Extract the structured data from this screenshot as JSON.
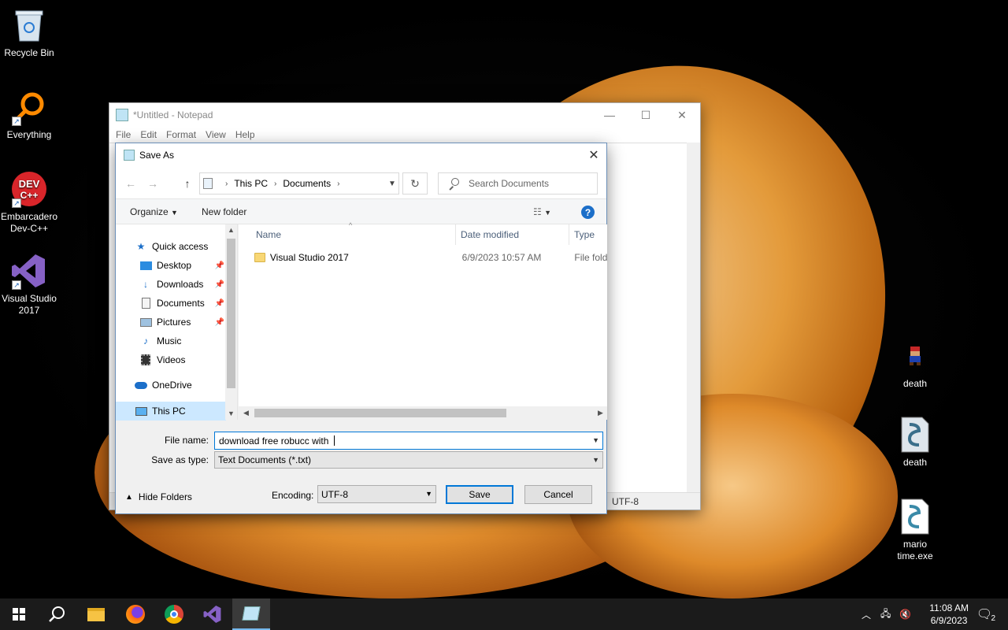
{
  "desktop": {
    "icons_left": [
      {
        "label": "Recycle Bin",
        "icon": "recycle-bin-icon"
      },
      {
        "label": "Everything",
        "icon": "everything-icon"
      },
      {
        "label": "Embarcadero Dev-C++",
        "icon": "dev-cpp-icon"
      },
      {
        "label": "Visual Studio 2017",
        "icon": "visual-studio-icon"
      }
    ],
    "icons_right": [
      {
        "label": "death",
        "icon": "mario-sprite-icon"
      },
      {
        "label": "death",
        "icon": "python-file-icon"
      },
      {
        "label": "mario time.exe",
        "icon": "python-file-icon"
      }
    ]
  },
  "notepad": {
    "title": "*Untitled - Notepad",
    "menu": [
      "File",
      "Edit",
      "Format",
      "View",
      "Help"
    ],
    "status_encoding": "UTF-8"
  },
  "save_dialog": {
    "title": "Save As",
    "breadcrumb": [
      "This PC",
      "Documents"
    ],
    "search_placeholder": "Search Documents",
    "toolbar": {
      "organize": "Organize",
      "new_folder": "New folder"
    },
    "nav": {
      "quick_access": "Quick access",
      "items": [
        "Desktop",
        "Downloads",
        "Documents",
        "Pictures",
        "Music",
        "Videos"
      ],
      "onedrive": "OneDrive",
      "this_pc": "This PC"
    },
    "columns": [
      "Name",
      "Date modified",
      "Type"
    ],
    "files": [
      {
        "name": "Visual Studio 2017",
        "date": "6/9/2023 10:57 AM",
        "type": "File fold"
      }
    ],
    "file_name_label": "File name:",
    "file_name_value": "download free robucc with ",
    "save_type_label": "Save as type:",
    "save_type_value": "Text Documents (*.txt)",
    "hide_folders": "Hide Folders",
    "encoding_label": "Encoding:",
    "encoding_value": "UTF-8",
    "save_button": "Save",
    "cancel_button": "Cancel"
  },
  "taskbar": {
    "time": "11:08 AM",
    "date": "6/9/2023",
    "notification_count": "2"
  }
}
